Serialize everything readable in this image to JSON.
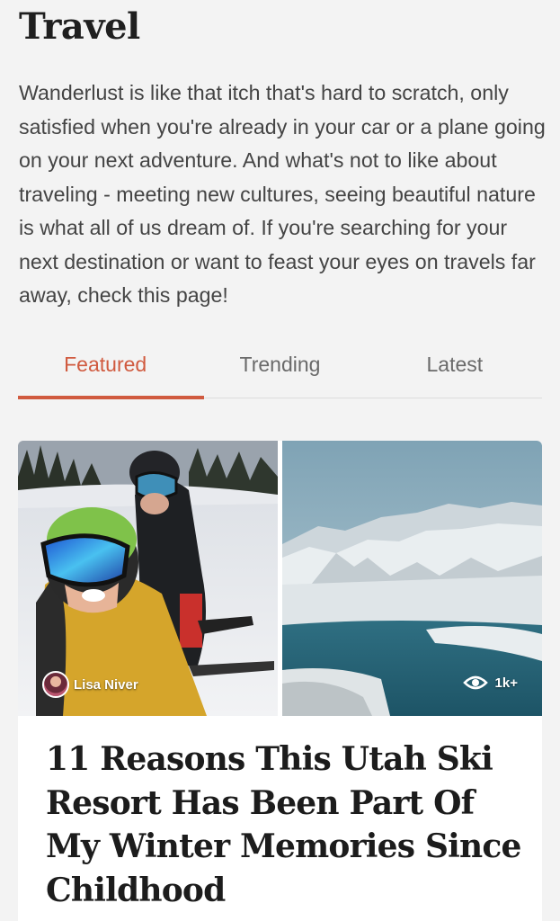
{
  "page": {
    "title": "Travel",
    "intro": "Wanderlust is like that itch that's hard to scratch, only satisfied when you're already in your car or a plane going on your next adventure. And what's not to like about traveling - meeting new cultures, seeing beautiful nature is what all of us dream of. If you're searching for your next destination or want to feast your eyes on travels far away, check this page!"
  },
  "tabs": [
    {
      "label": "Featured",
      "active": true
    },
    {
      "label": "Trending",
      "active": false
    },
    {
      "label": "Latest",
      "active": false
    }
  ],
  "card": {
    "author": "Lisa Niver",
    "views": "1k+",
    "headline": "11 Reasons This Utah Ski Resort Has Been Part Of My Winter Memories Since Childhood",
    "images": [
      "ski-selfie-photo",
      "mountain-lake-photo"
    ]
  },
  "colors": {
    "accent": "#d05a3f",
    "background": "#f3f3f3",
    "text": "#1f1f1f"
  },
  "icons": {
    "views": "eye-icon"
  }
}
